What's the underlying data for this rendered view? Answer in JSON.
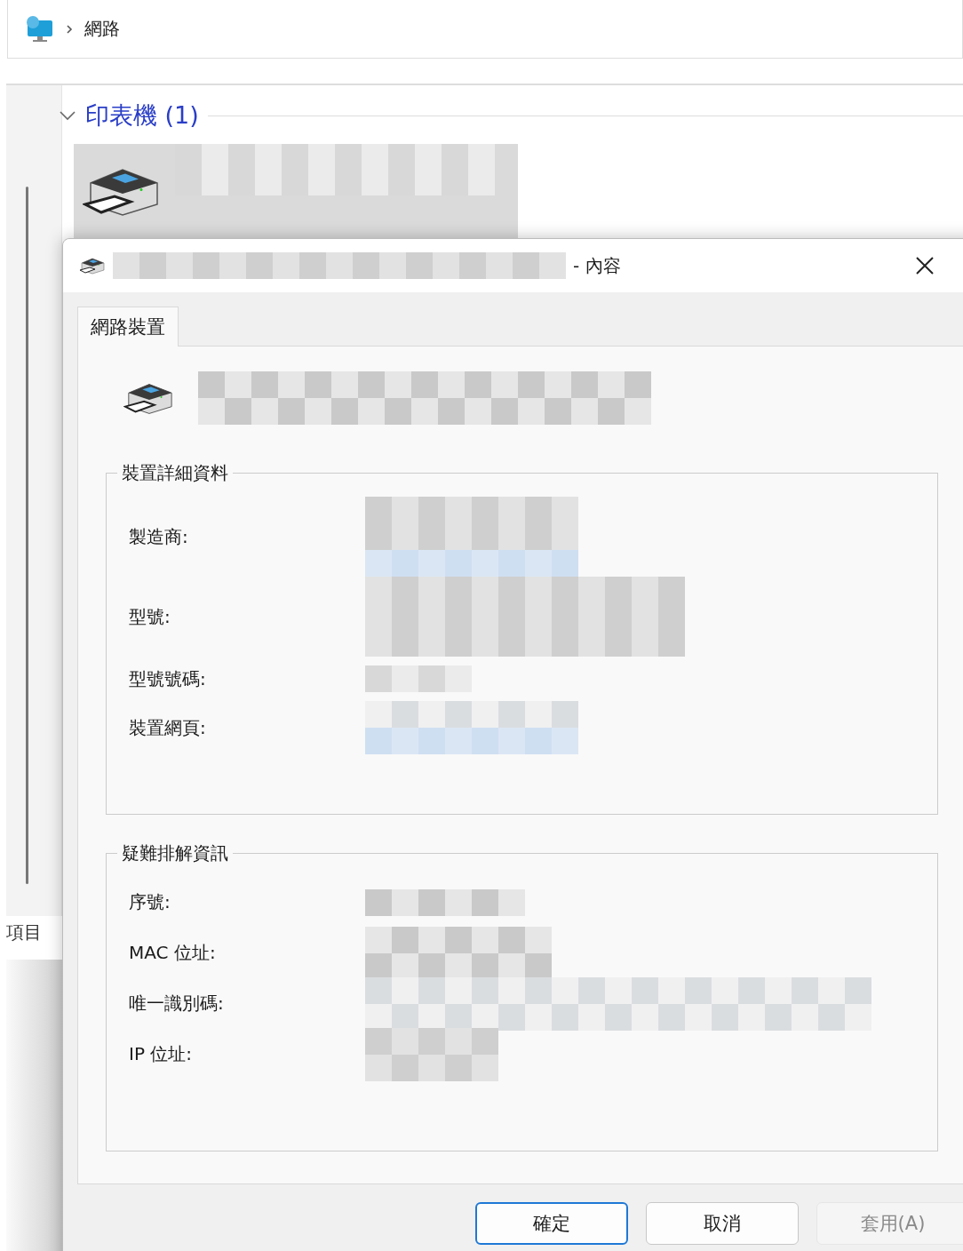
{
  "explorer": {
    "breadcrumb": [
      "網路"
    ],
    "group": {
      "title": "印表機 (1)",
      "expanded": true
    },
    "tile": {
      "selected": true
    },
    "status_text": "項目"
  },
  "dialog": {
    "title_suffix": "- 內容",
    "tabs": [
      {
        "label": "網路裝置",
        "selected": true
      }
    ],
    "sections": [
      {
        "title": "裝置詳細資料",
        "fields": [
          {
            "label": "製造商:"
          },
          {
            "label": "型號:"
          },
          {
            "label": "型號號碼:"
          },
          {
            "label": "裝置網頁:"
          }
        ]
      },
      {
        "title": "疑難排解資訊",
        "fields": [
          {
            "label": "序號:"
          },
          {
            "label": "MAC 位址:"
          },
          {
            "label": "唯一識別碼:"
          },
          {
            "label": "IP 位址:"
          }
        ]
      }
    ],
    "buttons": [
      {
        "label": "確定",
        "default": true,
        "disabled": false
      },
      {
        "label": "取消",
        "default": false,
        "disabled": false
      },
      {
        "label": "套用(A)",
        "default": false,
        "disabled": true
      }
    ]
  }
}
